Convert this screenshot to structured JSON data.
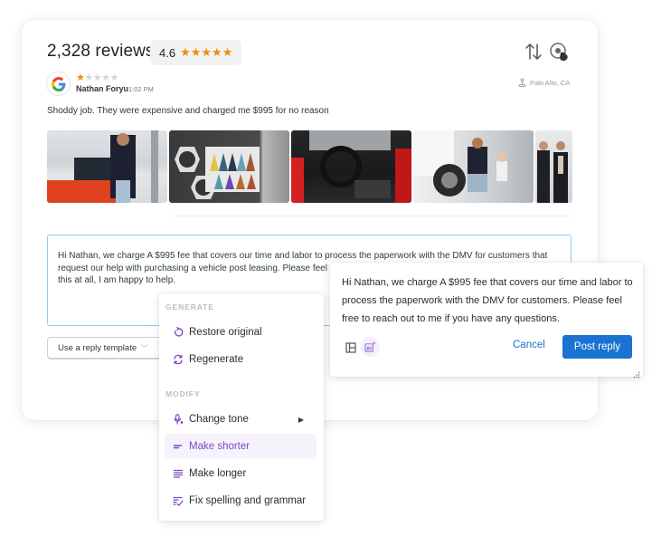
{
  "header": {
    "reviews_count": "2,328 reviews",
    "rating_value": "4.6",
    "rating_stars": "★★★★★",
    "sort_icon": "sort-arrows-icon",
    "target_icon": "target-cursor-icon"
  },
  "review": {
    "source_icon": "google-icon",
    "stars_on": "★",
    "stars_off": "★★★★",
    "rating": 1,
    "rating_max": 5,
    "author": "Nathan Foryu",
    "time": "1:02 PM",
    "location": "Palo Alto, CA",
    "text": "Shoddy job. They were expensive and charged me $995 for no reason",
    "photos": [
      "woman-in-car-showroom",
      "car-seat-material-display",
      "sports-car-interior",
      "woman-and-child-checking-tire",
      "two-men-in-showroom"
    ]
  },
  "reply": {
    "text": "Hi Nathan, we charge A $995 fee that covers our time and labor to process the paperwork with the DMV for customers that request our help with purchasing a vehicle post leasing. Please feel free to reach out to me if you have any questions about this at all, I am happy to help.",
    "template_select": "Use a reply template"
  },
  "menu": {
    "generate_label": "GENERATE",
    "modify_label": "MODIFY",
    "items": [
      {
        "label": "Restore original",
        "icon": "restore-icon"
      },
      {
        "label": "Regenerate",
        "icon": "regenerate-icon"
      },
      {
        "label": "Change tone",
        "icon": "tone-icon"
      },
      {
        "label": "Make shorter",
        "icon": "shorter-icon",
        "active": true
      },
      {
        "label": "Make longer",
        "icon": "longer-icon"
      },
      {
        "label": "Fix spelling and grammar",
        "icon": "spelling-icon"
      }
    ]
  },
  "popup": {
    "text": "Hi Nathan, we charge A $995 fee that covers our time and labor to process the paperwork with the DMV for customers. Please feel free to reach out to me if you have any questions.",
    "cancel_label": "Cancel",
    "post_label": "Post reply",
    "ai_label": "AI"
  },
  "colors": {
    "accent_blue": "#1a73d1",
    "star_orange": "#f08a0c",
    "ai_purple": "#7a48c6",
    "input_border": "#8fcbea"
  }
}
